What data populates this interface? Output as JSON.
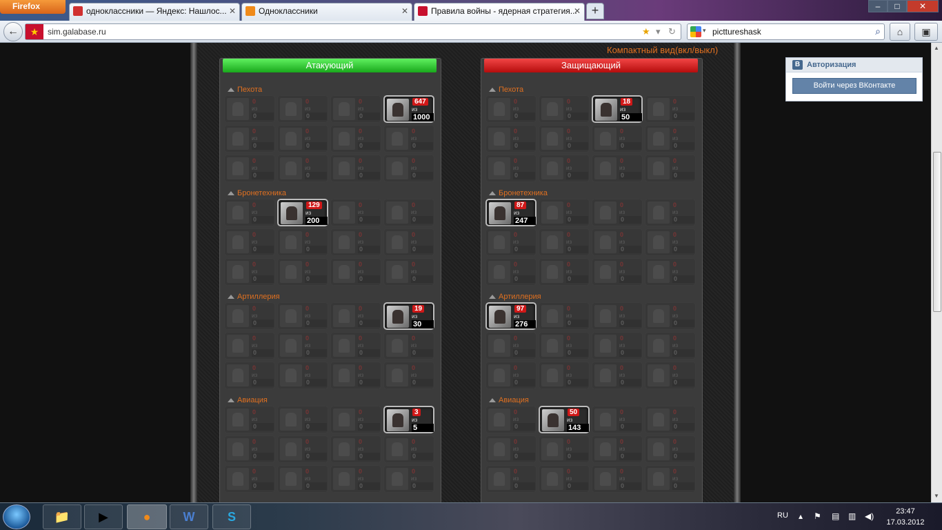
{
  "browser": {
    "app_button": "Firefox",
    "tabs": [
      {
        "title": "одноклассники — Яндекс: Нашлос...",
        "favicon_color": "#d03030",
        "active": false
      },
      {
        "title": "Одноклассники",
        "favicon_color": "#f08a1a",
        "active": false
      },
      {
        "title": "Правила войны - ядерная стратегия...",
        "favicon_color": "#c8102e",
        "active": true
      }
    ],
    "url": "sim.galabase.ru",
    "search_value": "picttureshask"
  },
  "page": {
    "compact_link": "Компактный вид(вкл/выкл)",
    "attacker": {
      "header": "Атакующий",
      "sections": [
        {
          "title": "Пехота",
          "units": [
            {
              "count": "0",
              "total": "0"
            },
            {
              "count": "0",
              "total": "0"
            },
            {
              "count": "0",
              "total": "0"
            },
            {
              "count": "647",
              "total": "1000",
              "active": true
            },
            {
              "count": "0",
              "total": "0"
            },
            {
              "count": "0",
              "total": "0"
            },
            {
              "count": "0",
              "total": "0"
            },
            {
              "count": "0",
              "total": "0"
            },
            {
              "count": "0",
              "total": "0"
            },
            {
              "count": "0",
              "total": "0"
            },
            {
              "count": "0",
              "total": "0"
            },
            {
              "count": "0",
              "total": "0"
            }
          ]
        },
        {
          "title": "Бронетехника",
          "units": [
            {
              "count": "0",
              "total": "0"
            },
            {
              "count": "129",
              "total": "200",
              "active": true
            },
            {
              "count": "0",
              "total": "0"
            },
            {
              "count": "0",
              "total": "0"
            },
            {
              "count": "0",
              "total": "0"
            },
            {
              "count": "0",
              "total": "0"
            },
            {
              "count": "0",
              "total": "0"
            },
            {
              "count": "0",
              "total": "0"
            },
            {
              "count": "0",
              "total": "0"
            },
            {
              "count": "0",
              "total": "0"
            },
            {
              "count": "0",
              "total": "0"
            },
            {
              "count": "0",
              "total": "0"
            }
          ]
        },
        {
          "title": "Артиллерия",
          "units": [
            {
              "count": "0",
              "total": "0"
            },
            {
              "count": "0",
              "total": "0"
            },
            {
              "count": "0",
              "total": "0"
            },
            {
              "count": "19",
              "total": "30",
              "active": true
            },
            {
              "count": "0",
              "total": "0"
            },
            {
              "count": "0",
              "total": "0"
            },
            {
              "count": "0",
              "total": "0"
            },
            {
              "count": "0",
              "total": "0"
            },
            {
              "count": "0",
              "total": "0"
            },
            {
              "count": "0",
              "total": "0"
            },
            {
              "count": "0",
              "total": "0"
            },
            {
              "count": "0",
              "total": "0"
            }
          ]
        },
        {
          "title": "Авиация",
          "units": [
            {
              "count": "0",
              "total": "0"
            },
            {
              "count": "0",
              "total": "0"
            },
            {
              "count": "0",
              "total": "0"
            },
            {
              "count": "3",
              "total": "5",
              "active": true
            },
            {
              "count": "0",
              "total": "0"
            },
            {
              "count": "0",
              "total": "0"
            },
            {
              "count": "0",
              "total": "0"
            },
            {
              "count": "0",
              "total": "0"
            },
            {
              "count": "0",
              "total": "0"
            },
            {
              "count": "0",
              "total": "0"
            },
            {
              "count": "0",
              "total": "0"
            },
            {
              "count": "0",
              "total": "0"
            }
          ]
        }
      ]
    },
    "defender": {
      "header": "Защищающий",
      "sections": [
        {
          "title": "Пехота",
          "units": [
            {
              "count": "0",
              "total": "0"
            },
            {
              "count": "0",
              "total": "0"
            },
            {
              "count": "18",
              "total": "50",
              "active": true
            },
            {
              "count": "0",
              "total": "0"
            },
            {
              "count": "0",
              "total": "0"
            },
            {
              "count": "0",
              "total": "0"
            },
            {
              "count": "0",
              "total": "0"
            },
            {
              "count": "0",
              "total": "0"
            },
            {
              "count": "0",
              "total": "0"
            },
            {
              "count": "0",
              "total": "0"
            },
            {
              "count": "0",
              "total": "0"
            },
            {
              "count": "0",
              "total": "0"
            }
          ]
        },
        {
          "title": "Бронетехника",
          "units": [
            {
              "count": "87",
              "total": "247",
              "active": true
            },
            {
              "count": "0",
              "total": "0"
            },
            {
              "count": "0",
              "total": "0"
            },
            {
              "count": "0",
              "total": "0"
            },
            {
              "count": "0",
              "total": "0"
            },
            {
              "count": "0",
              "total": "0"
            },
            {
              "count": "0",
              "total": "0"
            },
            {
              "count": "0",
              "total": "0"
            },
            {
              "count": "0",
              "total": "0"
            },
            {
              "count": "0",
              "total": "0"
            },
            {
              "count": "0",
              "total": "0"
            },
            {
              "count": "0",
              "total": "0"
            }
          ]
        },
        {
          "title": "Артиллерия",
          "units": [
            {
              "count": "97",
              "total": "276",
              "active": true
            },
            {
              "count": "0",
              "total": "0"
            },
            {
              "count": "0",
              "total": "0"
            },
            {
              "count": "0",
              "total": "0"
            },
            {
              "count": "0",
              "total": "0"
            },
            {
              "count": "0",
              "total": "0"
            },
            {
              "count": "0",
              "total": "0"
            },
            {
              "count": "0",
              "total": "0"
            },
            {
              "count": "0",
              "total": "0"
            },
            {
              "count": "0",
              "total": "0"
            },
            {
              "count": "0",
              "total": "0"
            },
            {
              "count": "0",
              "total": "0"
            }
          ]
        },
        {
          "title": "Авиация",
          "units": [
            {
              "count": "0",
              "total": "0"
            },
            {
              "count": "50",
              "total": "143",
              "active": true
            },
            {
              "count": "0",
              "total": "0"
            },
            {
              "count": "0",
              "total": "0"
            },
            {
              "count": "0",
              "total": "0"
            },
            {
              "count": "0",
              "total": "0"
            },
            {
              "count": "0",
              "total": "0"
            },
            {
              "count": "0",
              "total": "0"
            },
            {
              "count": "0",
              "total": "0"
            },
            {
              "count": "0",
              "total": "0"
            },
            {
              "count": "0",
              "total": "0"
            },
            {
              "count": "0",
              "total": "0"
            }
          ]
        }
      ]
    },
    "unit_of_label": "из",
    "vk": {
      "title": "Авторизация",
      "logo": "B",
      "login_button": "Войти через ВКонтакте"
    }
  },
  "taskbar": {
    "language": "RU",
    "time": "23:47",
    "date": "17.03.2012",
    "apps": [
      "windows-explorer",
      "media-player",
      "firefox",
      "word",
      "skype"
    ]
  }
}
